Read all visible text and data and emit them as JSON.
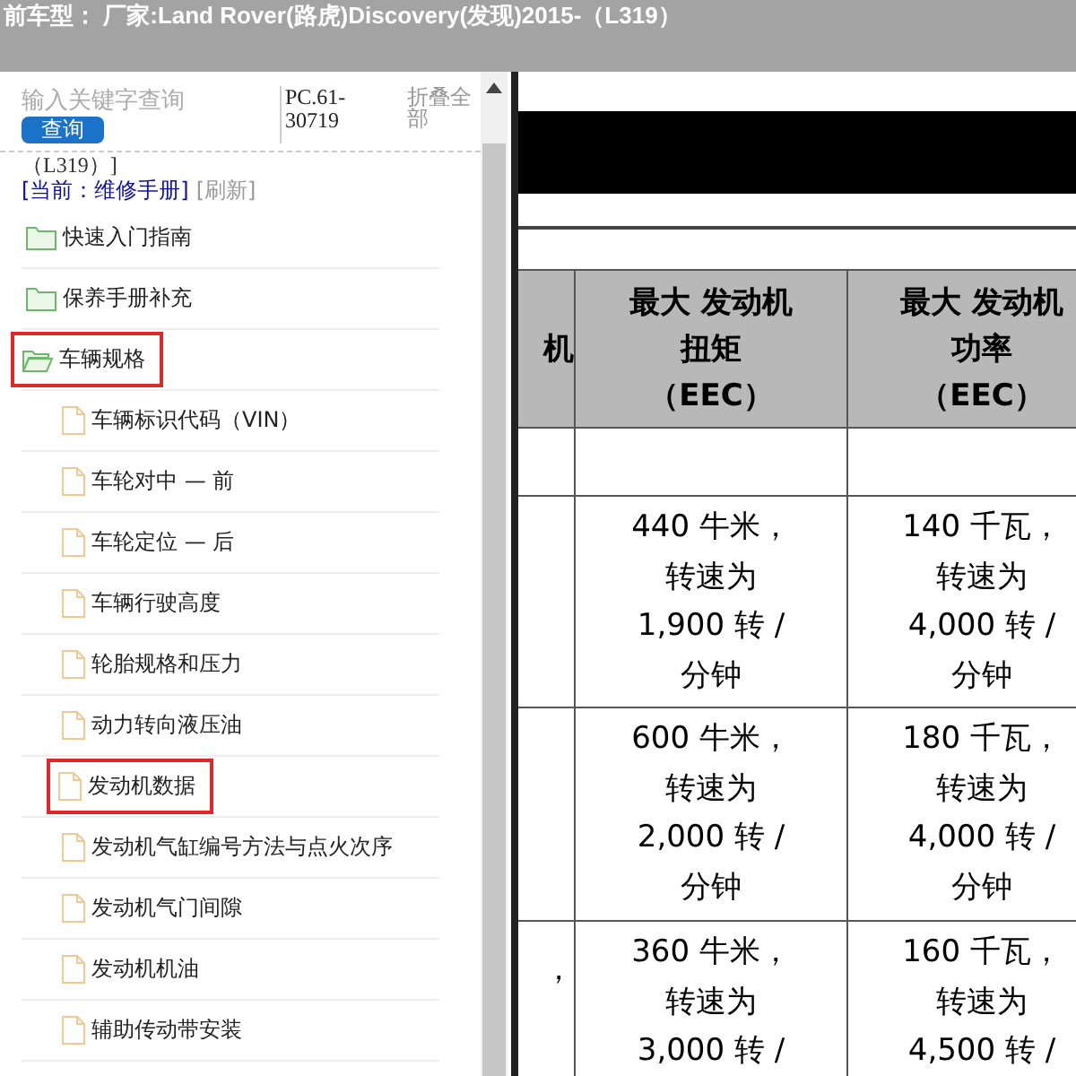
{
  "header": {
    "title": "前车型：  厂家:Land Rover(路虎)Discovery(发现)2015-（L319）"
  },
  "sidebar": {
    "search": {
      "placeholder": "输入关键字查询"
    },
    "search_button": "查询",
    "code": "PC.61-30719",
    "collapse_all": "折叠全部",
    "path_fragment": "（L319）]",
    "current": "[当前：维修手册]",
    "refresh": "[刷新]",
    "tree": [
      {
        "label": "快速入门指南",
        "kind": "folder",
        "expanded": false,
        "highlighted": false
      },
      {
        "label": "保养手册补充",
        "kind": "folder",
        "expanded": false,
        "highlighted": false
      },
      {
        "label": "车辆规格",
        "kind": "folder",
        "expanded": true,
        "highlighted": true,
        "children": [
          {
            "label": "车辆标识代码（VIN）",
            "kind": "file",
            "highlighted": false
          },
          {
            "label": "车轮对中 — 前",
            "kind": "file",
            "highlighted": false
          },
          {
            "label": "车轮定位 — 后",
            "kind": "file",
            "highlighted": false
          },
          {
            "label": "车辆行驶高度",
            "kind": "file",
            "highlighted": false
          },
          {
            "label": "轮胎规格和压力",
            "kind": "file",
            "highlighted": false
          },
          {
            "label": "动力转向液压油",
            "kind": "file",
            "highlighted": false
          },
          {
            "label": "发动机数据",
            "kind": "file",
            "highlighted": true
          },
          {
            "label": "发动机气缸编号方法与点火次序",
            "kind": "file",
            "highlighted": false
          },
          {
            "label": "发动机气门间隙",
            "kind": "file",
            "highlighted": false
          },
          {
            "label": "发动机机油",
            "kind": "file",
            "highlighted": false
          },
          {
            "label": "辅助传动带安装",
            "kind": "file",
            "highlighted": false
          }
        ]
      }
    ]
  },
  "document": {
    "table": {
      "columns": [
        "机",
        "最大 发动机扭矩（EEC）",
        "最大 发动机功率（EEC）"
      ],
      "rows": [
        [
          "",
          "",
          ""
        ],
        [
          "",
          "440 牛米，转速为1,900 转 / 分钟",
          "140 千瓦，转速为4,000 转 / 分钟"
        ],
        [
          "",
          "600 牛米，转速为2,000 转 / 分钟",
          "180 千瓦，转速为4,000 转 / 分钟"
        ],
        [
          "，",
          "360 牛米，转速为3,000 转 /",
          "160 千瓦，转速为4,500 转 /"
        ]
      ]
    }
  }
}
